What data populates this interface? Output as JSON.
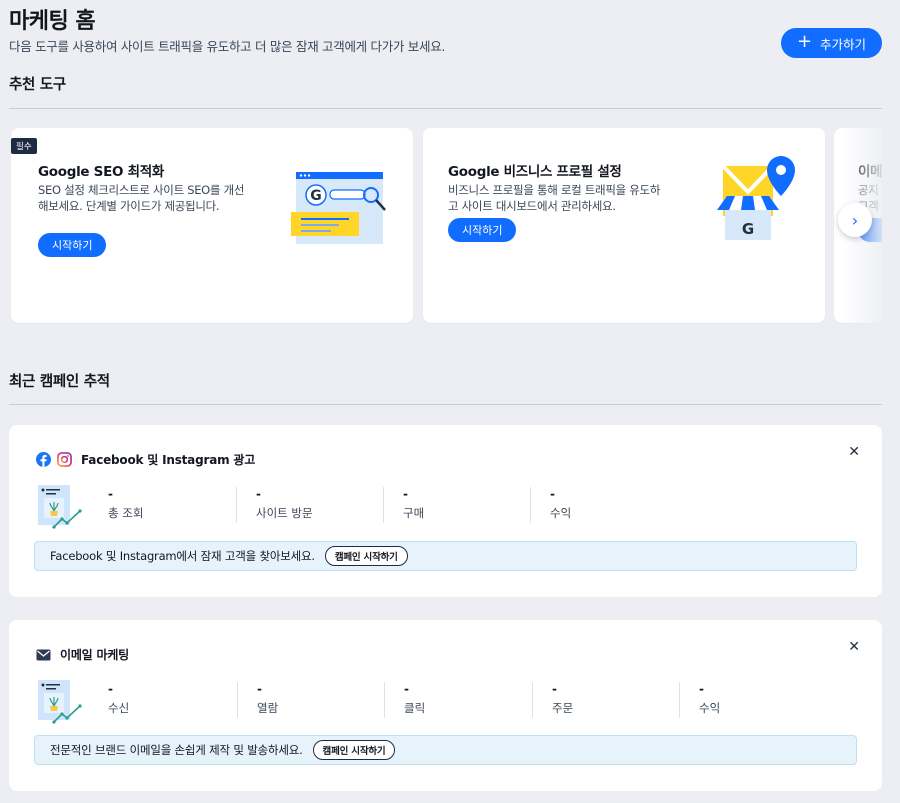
{
  "header": {
    "title": "마케팅 홈",
    "subtitle": "다음 도구를 사용하여 사이트 트래픽을 유도하고 더 많은 잠재 고객에게 다가가 보세요.",
    "add_label": "추가하기"
  },
  "recommended": {
    "title": "추천 도구",
    "cards": [
      {
        "badge": "필수",
        "title": "Google SEO 최적화",
        "desc": "SEO 설정 체크리스트로 사이트 SEO를 개선해보세요. 단계별 가이드가 제공됩니다.",
        "button": "시작하기"
      },
      {
        "title": "Google 비즈니스 프로필 설정",
        "desc": "비즈니스 프로필을 통해 로컬 트래픽을 유도하고 사이트 대시보드에서 관리하세요.",
        "button": "시작하기"
      },
      {
        "title": "이메",
        "desc_line1": "공지",
        "desc_line2": "고객"
      }
    ]
  },
  "tracking": {
    "title": "최근 캠페인 추적",
    "campaigns": [
      {
        "title": "Facebook 및 Instagram 광고",
        "stats": [
          {
            "value": "-",
            "label": "총 조회"
          },
          {
            "value": "-",
            "label": "사이트 방문"
          },
          {
            "value": "-",
            "label": "구매"
          },
          {
            "value": "-",
            "label": "수익"
          }
        ],
        "promo": "Facebook 및 Instagram에서 잠재 고객을 찾아보세요.",
        "button": "캠페인 시작하기"
      },
      {
        "title": "이메일 마케팅",
        "stats": [
          {
            "value": "-",
            "label": "수신"
          },
          {
            "value": "-",
            "label": "열람"
          },
          {
            "value": "-",
            "label": "클릭"
          },
          {
            "value": "-",
            "label": "주문"
          },
          {
            "value": "-",
            "label": "수익"
          }
        ],
        "promo": "전문적인 브랜드 이메일을 손쉽게 제작 및 발송하세요.",
        "button": "캠페인 시작하기"
      }
    ]
  },
  "icons": {
    "add": "plus-icon",
    "next": "chevron-right-icon",
    "close": "close-icon",
    "facebook": "facebook-icon",
    "instagram": "instagram-icon",
    "email": "envelope-icon"
  },
  "colors": {
    "accent": "#116dff",
    "background": "#eceef3",
    "badge": "#1f2a44",
    "promo_bg": "#e7f3fb",
    "illustration_yellow": "#ffd527"
  }
}
